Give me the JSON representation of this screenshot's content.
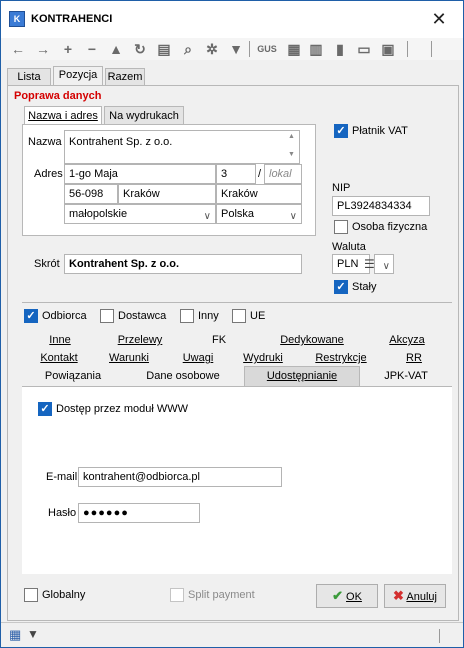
{
  "window": {
    "title": "KONTRAHENCI",
    "app_icon_label": "K",
    "close_glyph": "✕"
  },
  "toolbar": {
    "icons": [
      "back-arrow-icon",
      "forward-arrow-icon",
      "add-icon",
      "remove-icon",
      "warning-icon",
      "refresh-icon",
      "print-icon",
      "search-icon",
      "settings-icon",
      "filter-icon",
      "gus-icon",
      "import-icon",
      "document-icon",
      "card-icon",
      "person-icon"
    ],
    "gus_label": "GUS"
  },
  "main_tabs": [
    "Lista",
    "Pozycja",
    "Razem"
  ],
  "section_title": "Poprawa danych",
  "data_tabs": [
    "Nazwa i adres",
    "Na wydrukach"
  ],
  "name": {
    "label": "Nazwa",
    "value": "Kontrahent Sp. z o.o."
  },
  "address": {
    "label": "Adres",
    "street": "1-go Maja",
    "house": "3",
    "slash": "/",
    "apartment_placeholder": "lokal",
    "postal": "56-098",
    "city": "Kraków",
    "post_office": "Kraków",
    "region": "małopolskie",
    "country": "Polska"
  },
  "vat": {
    "label": "Płatnik VAT",
    "checked": true
  },
  "nip": {
    "label": "NIP",
    "value": "PL3924834334"
  },
  "natural_person": {
    "label": "Osoba fizyczna",
    "checked": false
  },
  "currency": {
    "label": "Waluta",
    "value": "PLN",
    "fixed_label": "Stały",
    "fixed_checked": true
  },
  "short_name": {
    "label": "Skrót",
    "value": "Kontrahent Sp. z o.o."
  },
  "types": [
    {
      "label": "Odbiorca",
      "checked": true
    },
    {
      "label": "Dostawca",
      "checked": false
    },
    {
      "label": "Inny",
      "checked": false
    },
    {
      "label": "UE",
      "checked": false
    }
  ],
  "detail_tabs_row1": [
    "Inne",
    "Przelewy",
    "FK",
    "Dedykowane",
    "Akcyza"
  ],
  "detail_tabs_row2": [
    "Kontakt",
    "Warunki",
    "Uwagi",
    "Wydruki",
    "Restrykcje",
    "RR"
  ],
  "detail_tabs_row3": [
    "Powiązania",
    "Dane osobowe",
    "Udostępnianie",
    "JPK-VAT"
  ],
  "www": {
    "label": "Dostęp przez moduł WWW",
    "checked": true
  },
  "email": {
    "label": "E-mail",
    "value": "kontrahent@odbiorca.pl"
  },
  "password": {
    "label": "Hasło",
    "value": "●●●●●●"
  },
  "footer": {
    "global_label": "Globalny",
    "split_label": "Split payment",
    "ok_label": "OK",
    "cancel_label": "Anuluj"
  },
  "colors": {
    "accent": "#1565c0",
    "title_red": "#d40000",
    "ok_green": "#3a9a3a",
    "cancel_red": "#d32f2f"
  }
}
